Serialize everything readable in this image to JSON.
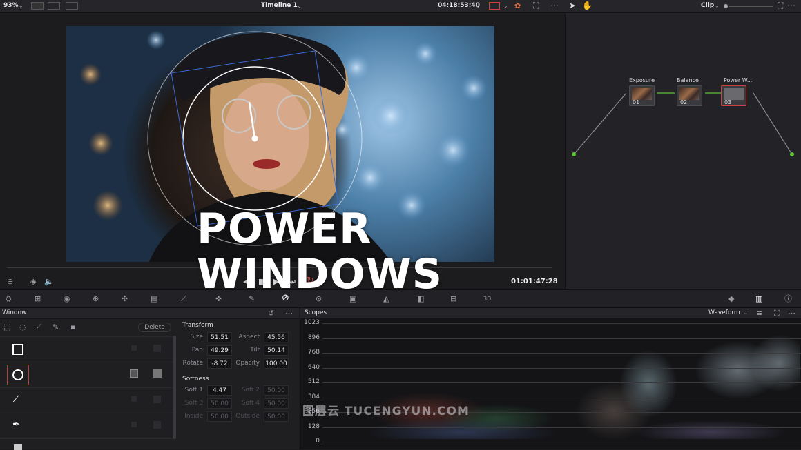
{
  "topbar": {
    "zoom": "93%",
    "timeline_title": "Timeline 1",
    "timecode": "04:18:53:40",
    "clip_label": "Clip"
  },
  "viewer": {
    "overlay_title": "POWER WINDOWS"
  },
  "transport": {
    "timecode": "01:01:47:28"
  },
  "nodes": [
    {
      "label": "Exposure",
      "num": "01"
    },
    {
      "label": "Balance",
      "num": "02"
    },
    {
      "label": "Power W...",
      "num": "03"
    }
  ],
  "window_panel": {
    "title": "Window",
    "delete_label": "Delete",
    "transform": {
      "header": "Transform",
      "size_label": "Size",
      "size": "51.51",
      "aspect_label": "Aspect",
      "aspect": "45.56",
      "pan_label": "Pan",
      "pan": "49.29",
      "tilt_label": "Tilt",
      "tilt": "50.14",
      "rotate_label": "Rotate",
      "rotate": "-8.72",
      "opacity_label": "Opacity",
      "opacity": "100.00"
    },
    "softness": {
      "header": "Softness",
      "soft1_label": "Soft 1",
      "soft1": "4.47",
      "soft2_label": "Soft 2",
      "soft2": "50.00",
      "soft3_label": "Soft 3",
      "soft3": "50.00",
      "soft4_label": "Soft 4",
      "soft4": "50.00",
      "inside_label": "Inside",
      "inside": "50.00",
      "outside_label": "Outside",
      "outside": "50.00"
    }
  },
  "scopes": {
    "title": "Scopes",
    "mode": "Waveform",
    "y_ticks": [
      "1023",
      "896",
      "768",
      "640",
      "512",
      "384",
      "256",
      "128",
      "0"
    ]
  },
  "watermark": "图层云 TUCENGYUN.COM",
  "colors": {
    "accent_red": "#e0403a",
    "node_green": "#5fc33a",
    "node_blue": "#3a8fe0"
  }
}
